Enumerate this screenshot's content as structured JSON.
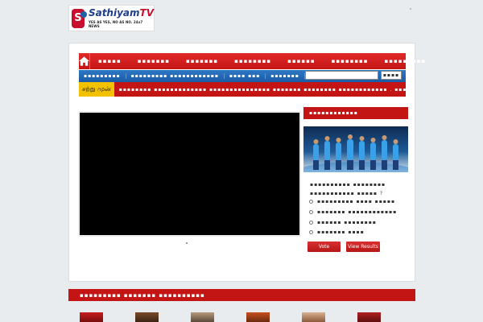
{
  "logo": {
    "title_part1": "Sathiyam",
    "title_part2": "TV",
    "tagline": "YES AS YES, NO AS NO. 24x7 NEWS",
    "mark": "S"
  },
  "nav": {
    "items": [
      "▪▪▪▪▪",
      "▪▪▪▪▪▪▪",
      "▪▪▪▪▪▪▪",
      "▪▪▪▪▪▪▪▪",
      "▪▪▪▪▪▪",
      "▪▪▪▪▪▪▪▪",
      "▪▪▪▪▪▪▪▪▪"
    ]
  },
  "subnav": {
    "items": [
      "▪▪▪▪▪▪▪▪▪",
      "▪▪▪▪▪▪▪▪▪ ▪▪▪▪▪▪▪▪▪▪▪▪",
      "▪▪▪▪ ▪▪▪",
      "▪▪▪▪▪▪▪"
    ]
  },
  "search": {
    "placeholder": "",
    "button_label": "▪▪▪▪"
  },
  "ticker": {
    "label": "சற்று முன்",
    "text": "▪▪▪▪▪▪▪▪ ▪▪▪▪▪▪▪▪▪▪▪▪▪ ▪▪▪▪▪▪▪▪▪▪▪▪▪▪▪ ▪▪▪▪▪▪▪ ▪▪▪▪▪▪▪▪ ▪▪▪▪▪▪▪▪▪▪▪▪ . ▪▪▪▪▪"
  },
  "poll": {
    "header": "▪▪▪▪▪▪▪▪▪▪▪▪",
    "question": "▪▪▪▪▪▪▪▪▪▪ ▪▪▪▪▪▪▪▪ ▪▪▪▪▪▪▪▪▪▪▪ ▪▪▪▪▪ ?",
    "options": [
      "▪▪▪▪▪▪▪▪▪ ▪▪▪▪ ▪▪▪▪▪",
      "▪▪▪▪▪▪▪ ▪▪▪▪▪▪▪▪▪▪▪▪",
      "▪▪▪▪▪▪ ▪▪▪▪▪▪▪▪",
      "▪▪▪▪▪▪▪ ▪▪▪▪"
    ],
    "vote_label": "Vote",
    "results_label": "View Results"
  },
  "bottom_section": {
    "header": "▪▪▪▪▪▪▪▪▪ ▪▪▪▪▪▪▪ ▪▪▪▪▪▪▪▪▪▪"
  },
  "colors": {
    "red": "#c41515",
    "blue": "#1a5ba6",
    "ticker_label": "#f2c200",
    "background": "#e9ecef"
  },
  "icons": {
    "home": "home-icon"
  }
}
